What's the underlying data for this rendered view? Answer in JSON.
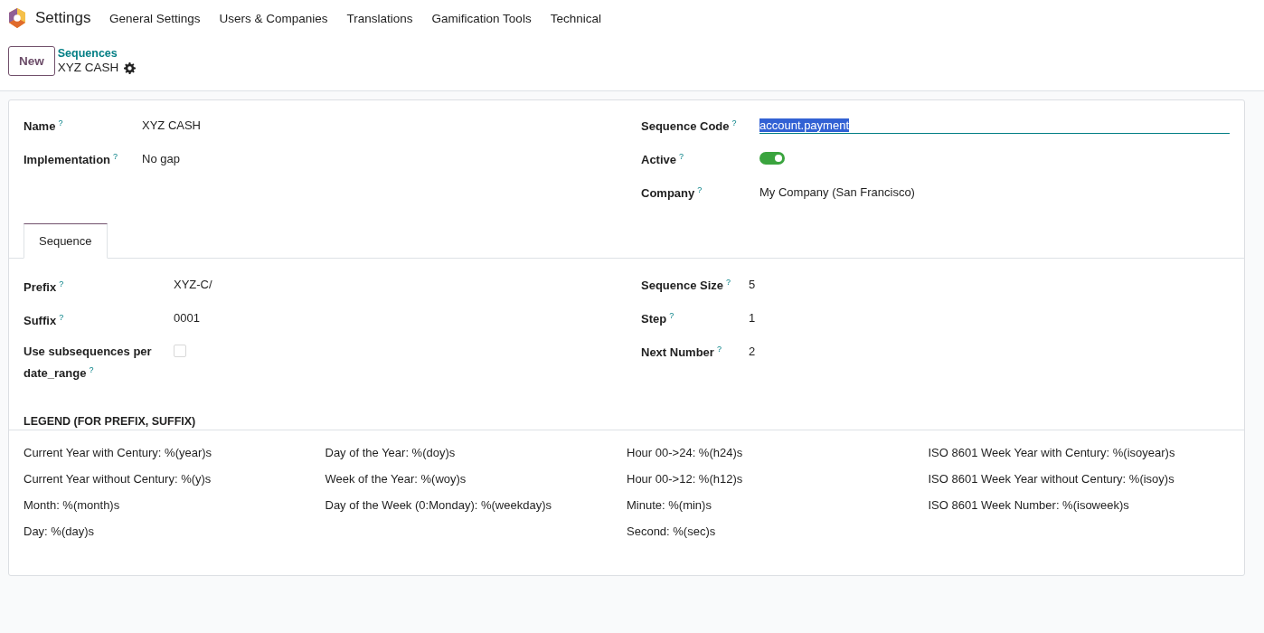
{
  "navbar": {
    "app_name": "Settings",
    "menu": [
      {
        "label": "General Settings"
      },
      {
        "label": "Users & Companies"
      },
      {
        "label": "Translations"
      },
      {
        "label": "Gamification Tools"
      },
      {
        "label": "Technical"
      }
    ]
  },
  "control_panel": {
    "new_button": "New",
    "breadcrumb": "Sequences",
    "record_title": "XYZ CASH"
  },
  "main_fields": {
    "left": [
      {
        "label": "Name",
        "help": "?",
        "kind": "text",
        "value": "XYZ CASH"
      },
      {
        "label": "Implementation",
        "help": "?",
        "kind": "text",
        "value": "No gap"
      }
    ],
    "right": [
      {
        "label": "Sequence Code",
        "help": "?",
        "kind": "input",
        "value": "account.payment",
        "text_selected": true
      },
      {
        "label": "Active",
        "help": "?",
        "kind": "toggle",
        "on": true
      },
      {
        "label": "Company",
        "help": "?",
        "kind": "text",
        "value": "My Company (San Francisco)"
      }
    ]
  },
  "tabs": [
    {
      "label": "Sequence",
      "selected": true
    }
  ],
  "sequence_fields": {
    "left": [
      {
        "label": "Prefix",
        "help": "?",
        "kind": "text",
        "value": "XYZ-C/"
      },
      {
        "label": "Suffix",
        "help": "?",
        "kind": "text",
        "value": "0001"
      },
      {
        "label": "Use subsequences per date_range",
        "help": "?",
        "kind": "checkbox",
        "checked": false
      }
    ],
    "right": [
      {
        "label": "Sequence Size",
        "help": "?",
        "kind": "text",
        "value": "5"
      },
      {
        "label": "Step",
        "help": "?",
        "kind": "text",
        "value": "1"
      },
      {
        "label": "Next Number",
        "help": "?",
        "kind": "text",
        "value": "2"
      }
    ]
  },
  "legend": {
    "title": "LEGEND (FOR PREFIX, SUFFIX)",
    "columns": [
      [
        "Current Year with Century: %(year)s",
        "Current Year without Century: %(y)s",
        "Month: %(month)s",
        "Day: %(day)s"
      ],
      [
        "Day of the Year: %(doy)s",
        "Week of the Year: %(woy)s",
        "Day of the Week (0:Monday): %(weekday)s"
      ],
      [
        "Hour 00->24: %(h24)s",
        "Hour 00->12: %(h12)s",
        "Minute: %(min)s",
        "Second: %(sec)s"
      ],
      [
        "ISO 8601 Week Year with Century: %(isoyear)s",
        "ISO 8601 Week Year without Century: %(isoy)s",
        "ISO 8601 Week Number: %(isoweek)s"
      ]
    ]
  }
}
